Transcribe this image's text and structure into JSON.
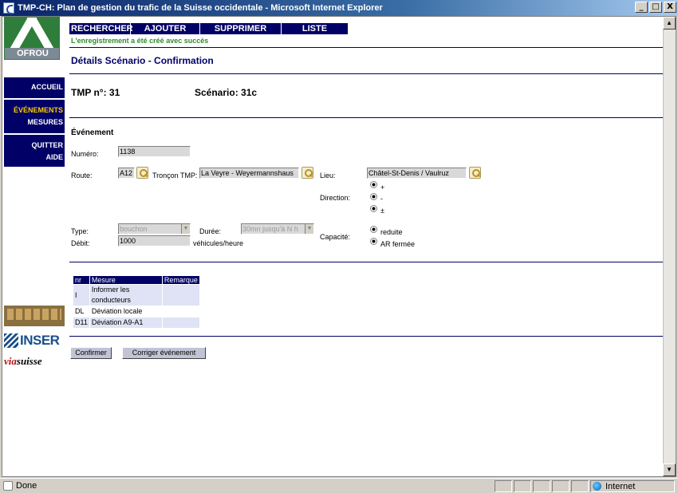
{
  "window": {
    "title": "TMP-CH: Plan de gestion du trafic de la Suisse occidentale - Microsoft Internet Explorer",
    "minimize": "_",
    "maximize": "□",
    "close": "X"
  },
  "logos": {
    "ofrou": "OFROU",
    "inser": "INSER",
    "via_prefix": "via",
    "via_suffix": "suisse"
  },
  "sidebar": {
    "items": [
      {
        "label": "ACCUEIL"
      },
      {
        "label": "ÉVÉNEMENTS"
      },
      {
        "label": "MESURES"
      },
      {
        "label": "QUITTER"
      },
      {
        "label": "AIDE"
      }
    ]
  },
  "topnav": {
    "items": [
      {
        "label": "RECHERCHER"
      },
      {
        "label": "AJOUTER"
      },
      {
        "label": "SUPPRIMER"
      },
      {
        "label": "LISTE"
      }
    ]
  },
  "success_message": "L'enregistrement a été créé avec succès",
  "page_title": "Détails Scénario - Confirmation",
  "tmp": {
    "label": "TMP n°: 31",
    "scenario": "Scénario: 31c"
  },
  "section_title": "Événement",
  "form": {
    "numero_label": "Numéro:",
    "numero_value": "1138",
    "route_label": "Route:",
    "route_value": "A12",
    "troncon_label": "Tronçon TMP:",
    "troncon_value": "La Veyre - Weyermannshaus",
    "lieu_label": "Lieu:",
    "lieu_value": "Châtel-St-Denis / Vaulruz",
    "direction_label": "Direction:",
    "direction_options": [
      "+",
      "-",
      "±"
    ],
    "type_label": "Type:",
    "type_value": "bouchon",
    "duree_label": "Durée:",
    "duree_value": "30mn jusqu'à N h",
    "debit_label": "Débit:",
    "debit_value": "1000",
    "debit_unit": "véhicules/heure",
    "capacite_label": "Capacité:",
    "capacite_options": [
      "reduite",
      "AR fermée"
    ]
  },
  "measures": {
    "headers": [
      "nr",
      "Mesure",
      "Remarque"
    ],
    "rows": [
      {
        "nr": "I",
        "mesure": "Informer les conducteurs",
        "remarque": ""
      },
      {
        "nr": "DL",
        "mesure": "Déviation locale",
        "remarque": ""
      },
      {
        "nr": "D11",
        "mesure": "Déviation A9-A1",
        "remarque": ""
      }
    ]
  },
  "buttons": {
    "confirm": "Confirmer",
    "correct": "Corriger événement"
  },
  "status": {
    "text": "Done",
    "zone": "Internet"
  }
}
